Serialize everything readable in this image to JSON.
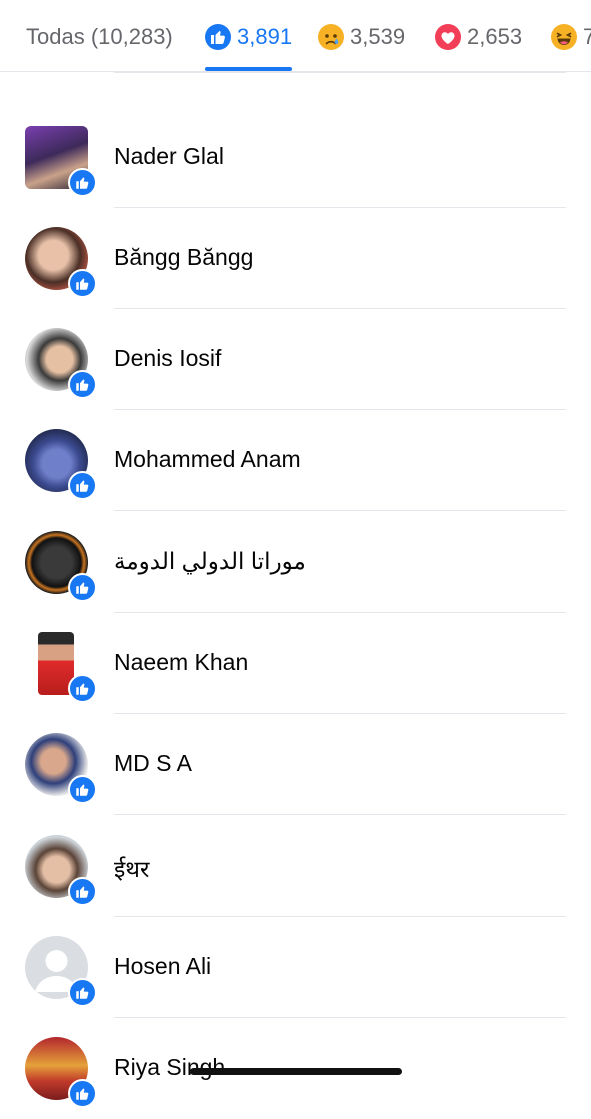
{
  "tabs": [
    {
      "label": "Todas (10,283)",
      "icon": null,
      "active": false
    },
    {
      "label": "3,891",
      "icon": "like-icon",
      "active": true
    },
    {
      "label": "3,539",
      "icon": "sad-icon",
      "active": false
    },
    {
      "label": "2,653",
      "icon": "love-icon",
      "active": false
    },
    {
      "label": "7",
      "icon": "haha-icon",
      "active": false
    }
  ],
  "colors": {
    "accent": "#1877f2",
    "divider": "#e4e6eb",
    "text": "#050505",
    "muted": "#65676b"
  },
  "people": [
    {
      "name": ""
    },
    {
      "name": "Nader Glal"
    },
    {
      "name": "Băngg Băngg"
    },
    {
      "name": "Denis Iosif"
    },
    {
      "name": "Mohammed Anam"
    },
    {
      "name": "موراتا الدولي الدومة"
    },
    {
      "name": "Naeem Khan"
    },
    {
      "name": "MD S A"
    },
    {
      "name": "ईथर"
    },
    {
      "name": "Hosen Ali"
    },
    {
      "name": "Riya Singh"
    }
  ]
}
